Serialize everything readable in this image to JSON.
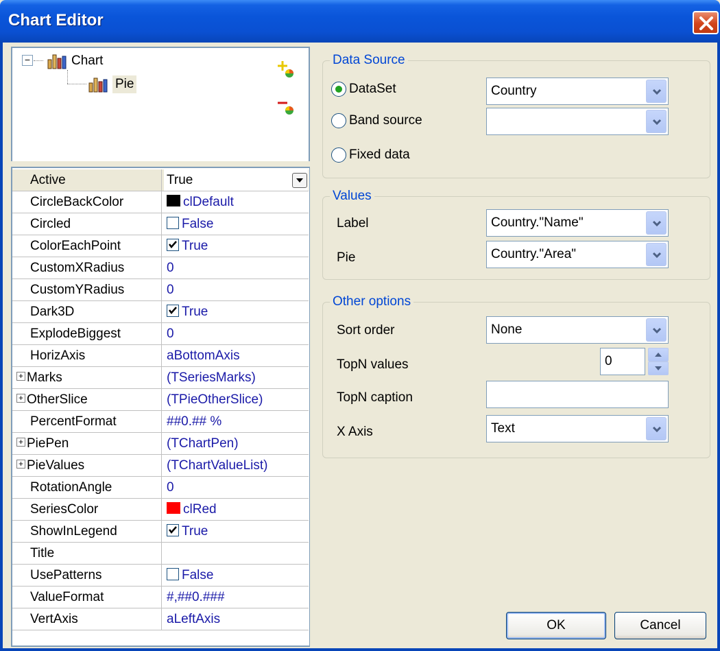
{
  "window": {
    "title": "Chart Editor"
  },
  "tree": {
    "root_label": "Chart",
    "child_label": "Pie",
    "expander": "−",
    "add_icon": "add-series-icon",
    "delete_icon": "delete-series-icon"
  },
  "properties": [
    {
      "name": "Active",
      "value": "True",
      "kind": "dropdown",
      "active": true
    },
    {
      "name": "CircleBackColor",
      "value": "clDefault",
      "kind": "color",
      "color": "#000000"
    },
    {
      "name": "Circled",
      "value": "False",
      "kind": "check",
      "checked": false
    },
    {
      "name": "ColorEachPoint",
      "value": "True",
      "kind": "check",
      "checked": true
    },
    {
      "name": "CustomXRadius",
      "value": "0",
      "kind": "text"
    },
    {
      "name": "CustomYRadius",
      "value": "0",
      "kind": "text"
    },
    {
      "name": "Dark3D",
      "value": "True",
      "kind": "check",
      "checked": true
    },
    {
      "name": "ExplodeBiggest",
      "value": "0",
      "kind": "text"
    },
    {
      "name": "HorizAxis",
      "value": "aBottomAxis",
      "kind": "text"
    },
    {
      "name": "Marks",
      "value": "(TSeriesMarks)",
      "kind": "expand"
    },
    {
      "name": "OtherSlice",
      "value": "(TPieOtherSlice)",
      "kind": "expand"
    },
    {
      "name": "PercentFormat",
      "value": "##0.## %",
      "kind": "text"
    },
    {
      "name": "PiePen",
      "value": "(TChartPen)",
      "kind": "expand"
    },
    {
      "name": "PieValues",
      "value": "(TChartValueList)",
      "kind": "expand"
    },
    {
      "name": "RotationAngle",
      "value": "0",
      "kind": "text"
    },
    {
      "name": "SeriesColor",
      "value": "clRed",
      "kind": "color",
      "color": "#ff0000"
    },
    {
      "name": "ShowInLegend",
      "value": "True",
      "kind": "check",
      "checked": true
    },
    {
      "name": "Title",
      "value": "",
      "kind": "text"
    },
    {
      "name": "UsePatterns",
      "value": "False",
      "kind": "check",
      "checked": false
    },
    {
      "name": "ValueFormat",
      "value": "#,##0.###",
      "kind": "text"
    },
    {
      "name": "VertAxis",
      "value": "aLeftAxis",
      "kind": "text"
    }
  ],
  "data_source": {
    "group_label": "Data Source",
    "dataset_label": "DataSet",
    "dataset_value": "Country",
    "band_label": "Band source",
    "band_value": "",
    "fixed_label": "Fixed data",
    "selected": "dataset"
  },
  "values": {
    "group_label": "Values",
    "label_label": "Label",
    "label_value": "Country.\"Name\"",
    "pie_label": "Pie",
    "pie_value": "Country.\"Area\""
  },
  "other": {
    "group_label": "Other options",
    "sort_label": "Sort order",
    "sort_value": "None",
    "topn_label": "TopN values",
    "topn_value": "0",
    "caption_label": "TopN caption",
    "caption_value": "",
    "xaxis_label": "X Axis",
    "xaxis_value": "Text"
  },
  "buttons": {
    "ok": "OK",
    "cancel": "Cancel"
  },
  "colors": {
    "title_blue": "#0a55d9",
    "group_label": "#0046d5",
    "value_text": "#1a1aa8"
  }
}
